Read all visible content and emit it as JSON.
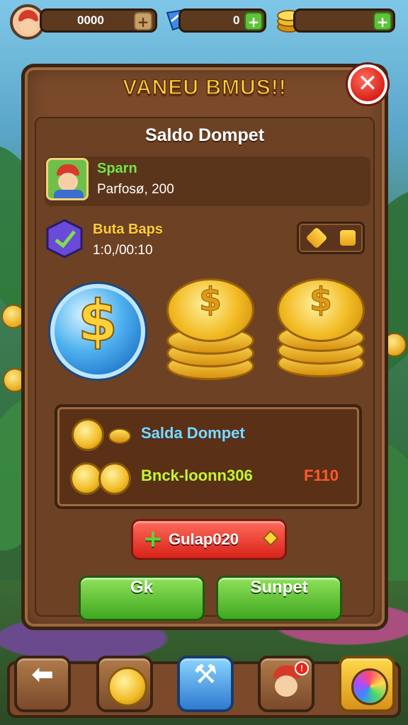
{
  "topbar": {
    "coins_value": "0000",
    "gems_value": "0",
    "gold_value": ""
  },
  "popup": {
    "title": "VANEU BMUS!!",
    "subtitle": "Saldo Dompet",
    "profile": {
      "name": "Sparn",
      "detail": "Parfosø, 200"
    },
    "bonus": {
      "name": "Buta Baps",
      "detail": "1:0,/00:10"
    },
    "wallet": {
      "label": "Salda Dompet",
      "code": "Bnck-loonn306",
      "amount": "F110"
    },
    "red_button_label": "Gulap020",
    "left_button_label": "Gk",
    "right_button_label": "Sunpet"
  },
  "icons": {
    "close": "close-icon",
    "plus": "plus-icon",
    "gem": "gem-icon",
    "coin": "coin-icon"
  },
  "colors": {
    "title_gold": "#ffd23a",
    "panel_wood": "#7a4a2a",
    "button_green": "#3fa820",
    "button_red": "#d8231a",
    "wallet_label": "#7fd8ff",
    "wallet_code": "#c6f23a",
    "wallet_amount": "#ff5a2a"
  }
}
